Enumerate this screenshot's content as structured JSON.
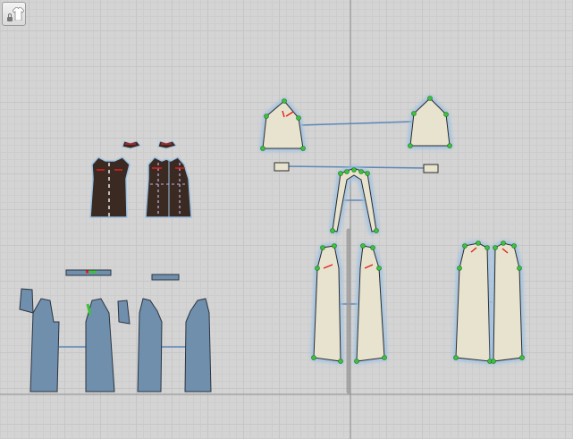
{
  "canvas": {
    "background": "#d4d4d4",
    "axis_color": "#8e8e8e"
  },
  "toolbar": {
    "tool_icon": "shirt-lock-icon",
    "locked": true
  },
  "colors": {
    "pattern_fill": "#e8e3cf",
    "pattern_outline": "#2b2b2b",
    "glow": "#9cc1e3",
    "point": "#3cc23c",
    "dart": "#e0201c",
    "link": "#5c87b8",
    "garment_blue": "#6f8fad",
    "garment_dark": "#3a2a22"
  }
}
